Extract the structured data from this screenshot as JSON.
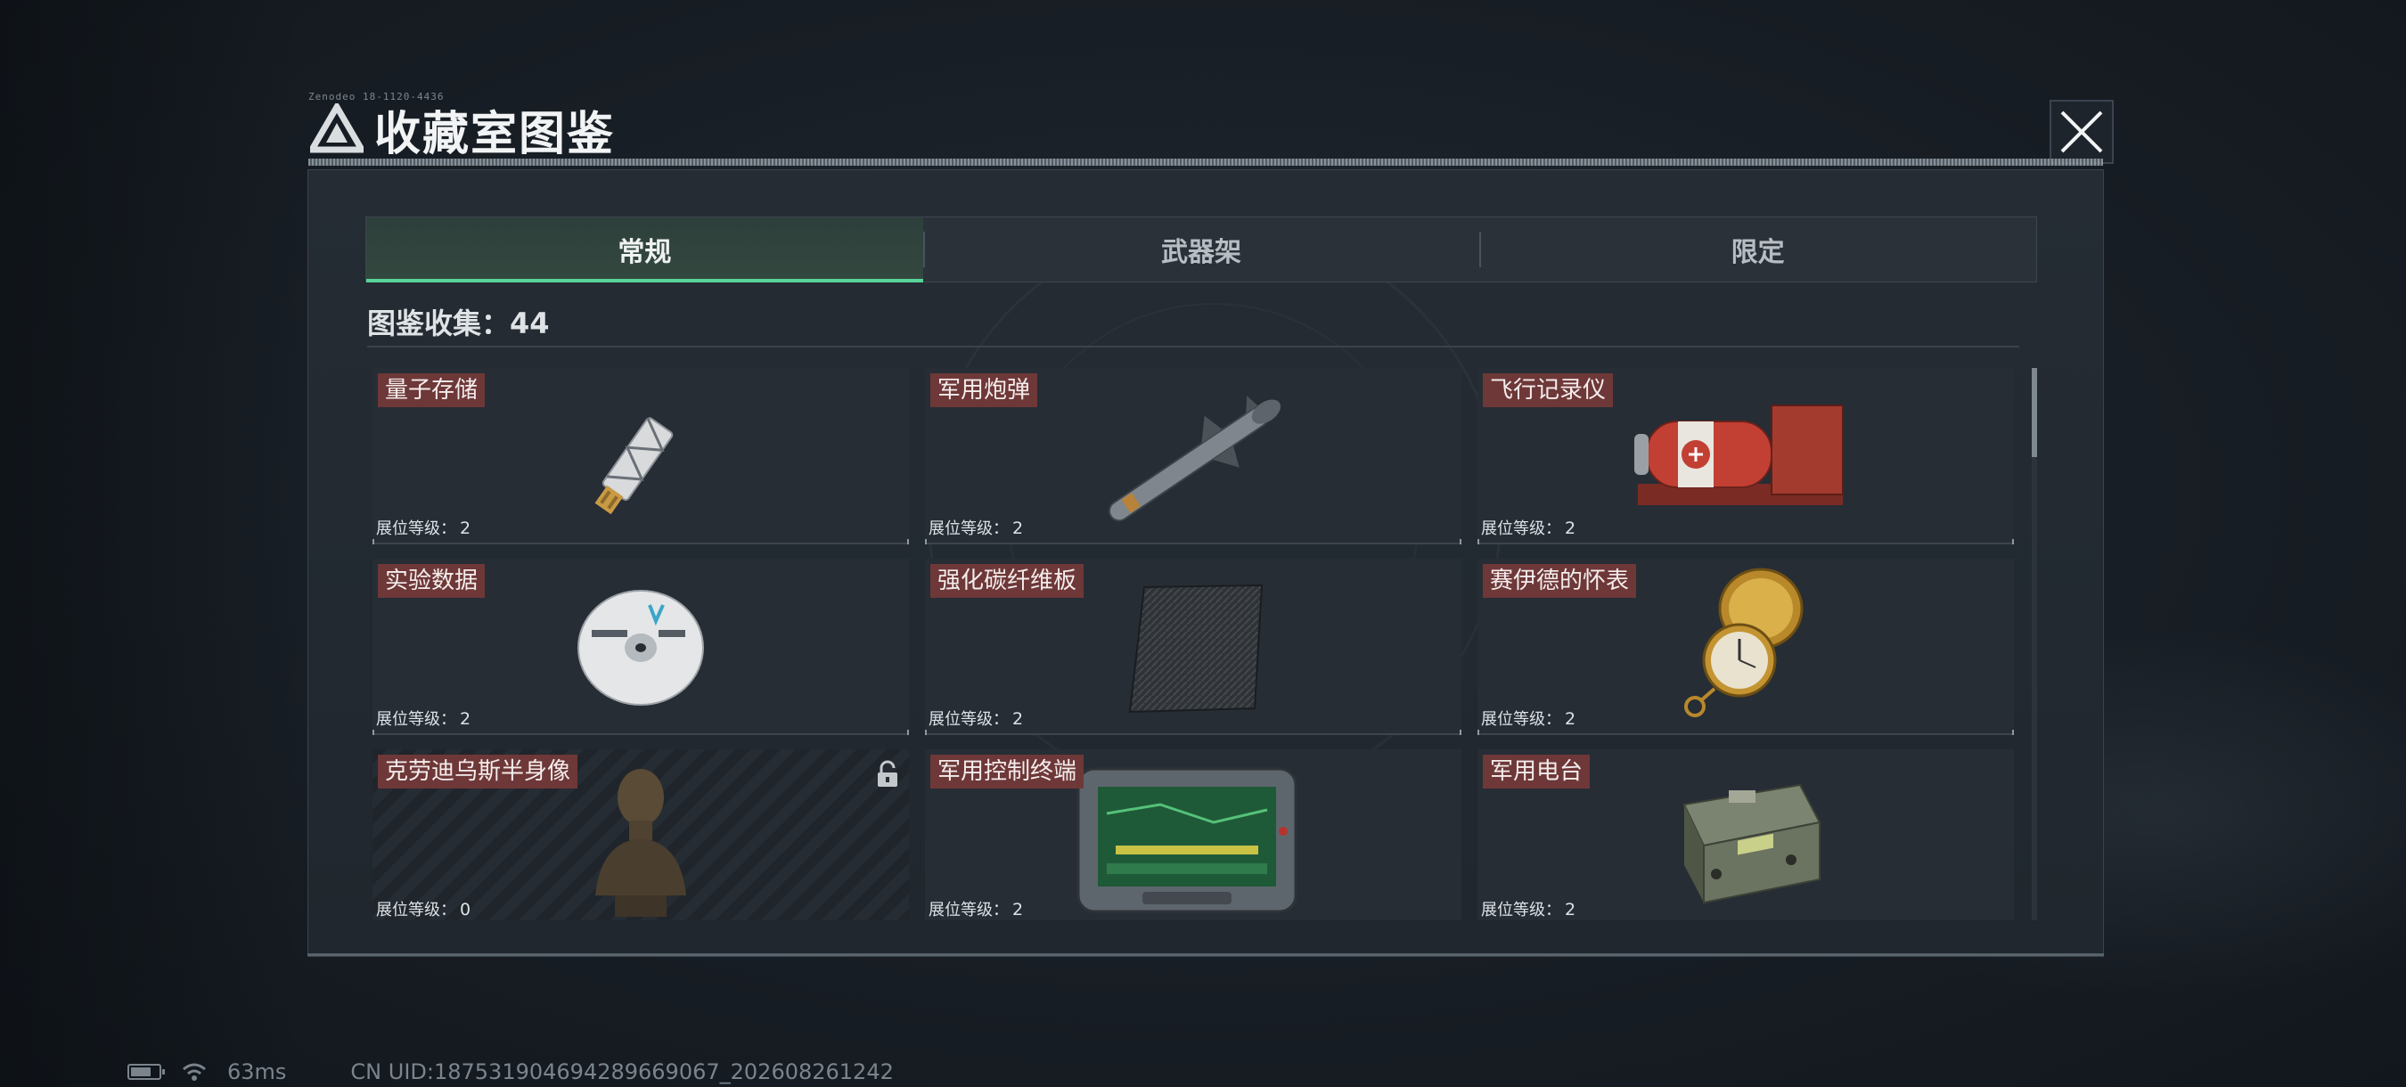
{
  "window": {
    "title": "收藏室图鉴",
    "header_code": "Zenodeo 18-1120-4436"
  },
  "tabs": [
    {
      "label": "常规",
      "active": true
    },
    {
      "label": "武器架",
      "active": false
    },
    {
      "label": "限定",
      "active": false
    }
  ],
  "collection": {
    "text": "图鉴收集：44"
  },
  "level_label": "展位等级：",
  "items": [
    {
      "name": "量子存储",
      "level": "2",
      "icon": "usb-drive-icon"
    },
    {
      "name": "军用炮弹",
      "level": "2",
      "icon": "missile-icon"
    },
    {
      "name": "飞行记录仪",
      "level": "2",
      "icon": "flight-recorder-icon"
    },
    {
      "name": "实验数据",
      "level": "2",
      "icon": "disc-icon"
    },
    {
      "name": "强化碳纤维板",
      "level": "2",
      "icon": "carbon-plate-icon"
    },
    {
      "name": "赛伊德的怀表",
      "level": "2",
      "icon": "pocket-watch-icon"
    },
    {
      "name": "克劳迪乌斯半身像",
      "level": "0",
      "icon": "bust-icon",
      "locked": true
    },
    {
      "name": "军用控制终端",
      "level": "2",
      "icon": "control-terminal-icon"
    },
    {
      "name": "军用电台",
      "level": "2",
      "icon": "radio-icon"
    }
  ],
  "status_bar": {
    "ping": "63ms",
    "uid": "CN UID:187531904694289669067_202608261242"
  },
  "colors": {
    "accent": "#58d49a",
    "label_bg": "#6e3838",
    "panel_bg": "#252c34"
  }
}
